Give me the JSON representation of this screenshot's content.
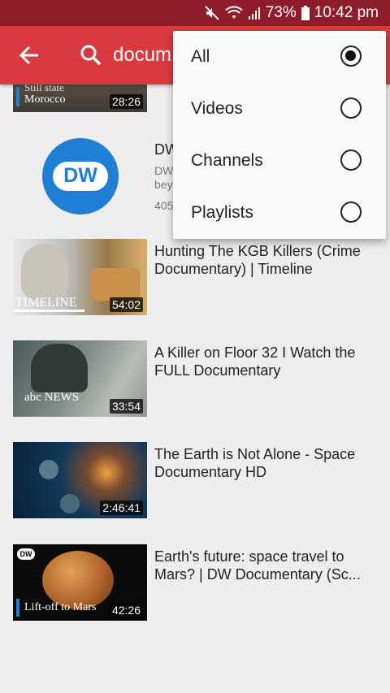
{
  "status_bar": {
    "battery": "73%",
    "time": "10:42 pm"
  },
  "app_bar": {
    "query": "docum"
  },
  "filter_menu": {
    "selected": "All",
    "options": [
      "All",
      "Videos",
      "Channels",
      "Playlists"
    ]
  },
  "results": {
    "partial_video": {
      "overlay_top": "Still state",
      "overlay_line": "Morocco",
      "duration": "28:26"
    },
    "channel": {
      "logo": "DW",
      "name": "DW",
      "desc_line1": "DW",
      "desc_line2": "bey",
      "count": "405"
    },
    "videos": [
      {
        "title": "Hunting The KGB Killers (Crime Documentary) | Timeline",
        "duration": "54:02",
        "overlay": "TIMELINE"
      },
      {
        "title": "A Killer on Floor 32 I Watch the FULL Documentary",
        "duration": "33:54",
        "overlay": "abc NEWS"
      },
      {
        "title": "The Earth is Not Alone - Space Documentary HD",
        "duration": "2:46:41",
        "overlay": ""
      },
      {
        "title": "Earth's future: space travel to Mars? | DW Documentary (Sc...",
        "duration": "42:26",
        "overlay": "Lift-off to Mars",
        "badge": "DW"
      }
    ]
  },
  "colors": {
    "status_bar": "#8e1c2a",
    "app_bar": "#d93a3f",
    "dw_blue": "#1f7fd4",
    "background": "#eeeeee"
  }
}
